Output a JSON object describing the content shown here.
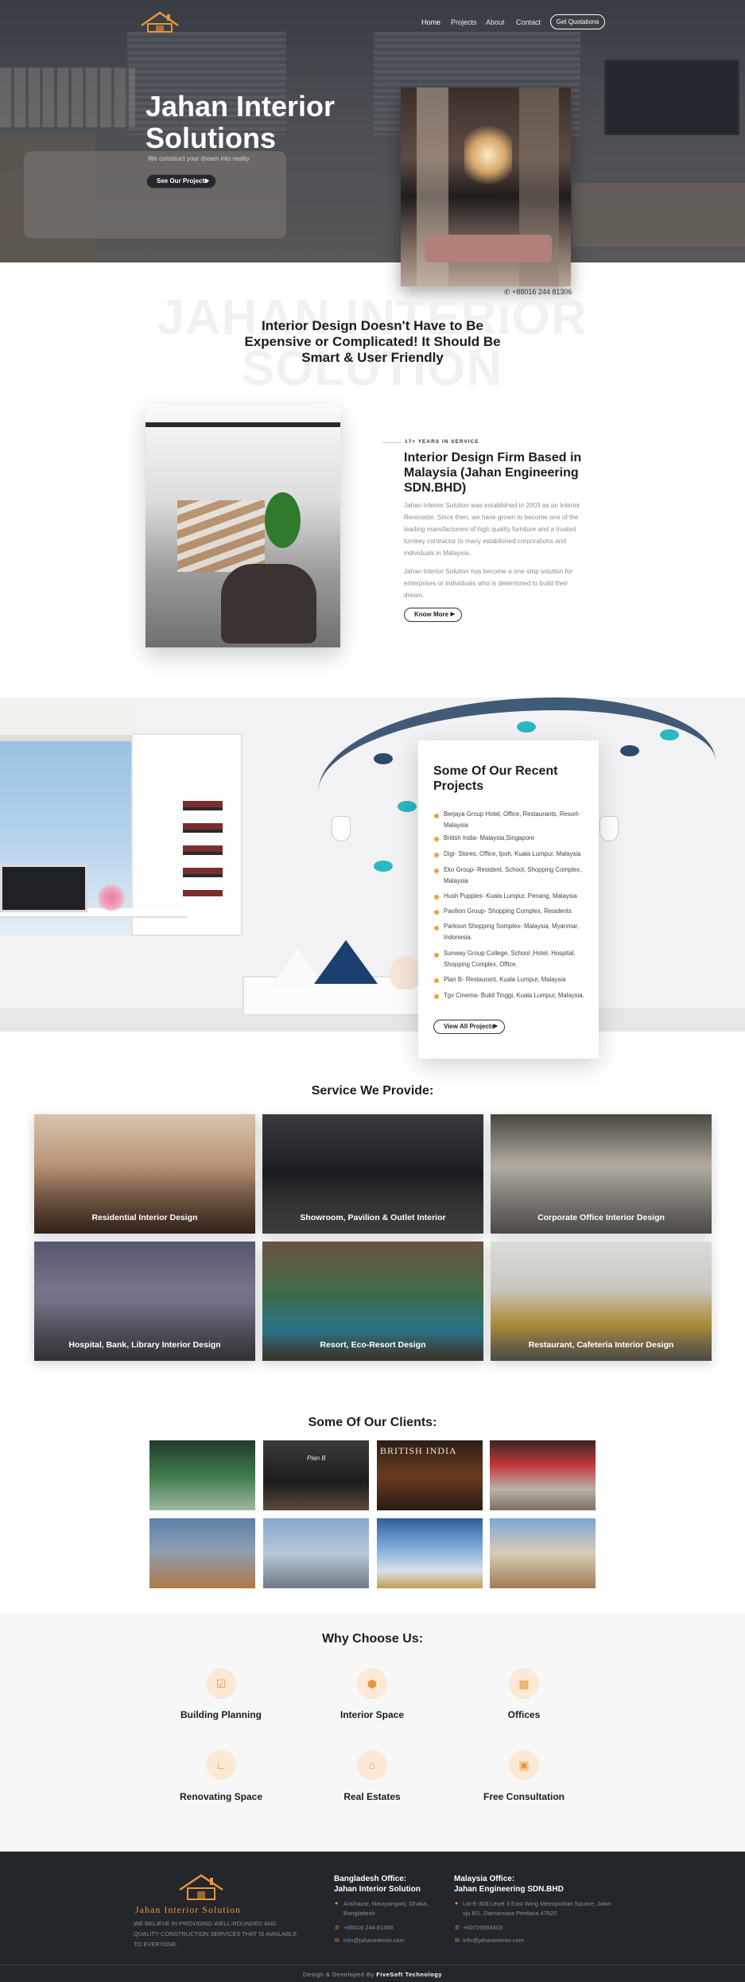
{
  "nav": {
    "items": [
      "Home",
      "Projects",
      "About",
      "Contact"
    ],
    "cta": "Get Quotations"
  },
  "hero": {
    "title": "Jahan Interior Solutions",
    "subtitle": "We construct your dream into reality",
    "button": "See Our Projects",
    "phone": "+88016 244 81306"
  },
  "intro": {
    "watermark": "JAHAN INTERIOR SOLUTION",
    "heading": "Interior Design Doesn't Have to Be Expensive or Complicated! It Should Be Smart & User Friendly"
  },
  "about": {
    "eyebrow": "17+ YEARS IN SERVICE",
    "title": "Interior Design Firm Based in Malaysia (Jahan Engineering SDN.BHD)",
    "para1": "Jahan Interior Solution was established in 2003 as an Interior Renovator. Since then, we have grown to become one of the leading manufacturers of high quality furniture and a trusted turnkey contractor to many established corporations and individuals in Malaysia.",
    "para2": "Jahan Interior Solution has become a one-stop solution for enterprises or individuals who is determined to build their dream.",
    "button": "Know More"
  },
  "projects": {
    "title": "Some Of Our Recent Projects",
    "items": [
      "Berjaya Group Hotel, Office, Restaurants, Resort- Malaysia",
      "British India- Malaysia,Singapore",
      "Digi- Stores, Office, Ipoh, Kuala Lumpur, Malaysia",
      "Eko Group- Resident, School, Shopping Complex, Malaysia",
      "Hush Puppies- Kuala Lumpur, Penang, Malaysia",
      "Pavilion Group- Shopping Complex, Residents",
      "Parkson Shopping Somplex- Malaysia, Myanmar, Indonesia.",
      "Sunway Group College, School ,Hotel, Hospital, Shopping Complex, Office.",
      "Plan B- Restaurant, Kuala Lumpur, Malaysia",
      "Tgv Cinema- Bukit Tinggi, Kuala Lumpur, Malaysia."
    ],
    "button": "View All Projects"
  },
  "services": {
    "title": "Service We Provide:",
    "items": [
      "Residential Interior Design",
      "Showroom, Pavilion & Outlet Interior",
      "Corporate Office Interior Design",
      "Hospital, Bank, Library Interior Design",
      "Resort, Eco-Resort Design",
      "Restaurant, Cafeteria Interior Design"
    ]
  },
  "clients": {
    "title": "Some Of Our Clients:",
    "signs": [
      "Plan B",
      "BRITISH INDIA"
    ]
  },
  "why": {
    "title": "Why Choose Us:",
    "items": [
      {
        "label": "Building Planning",
        "icon": "clipboard-check-icon"
      },
      {
        "label": "Interior Space",
        "icon": "cube-icon"
      },
      {
        "label": "Offices",
        "icon": "building-icon"
      },
      {
        "label": "Renovating Space",
        "icon": "angle-ruler-icon"
      },
      {
        "label": "Real Estates",
        "icon": "home-icon"
      },
      {
        "label": "Free Consultation",
        "icon": "briefcase-icon"
      }
    ]
  },
  "footer": {
    "brand": "Jahan Interior Solution",
    "tagline": "WE BELIEVE IN PROVIDING WELL-ROUNDED AND QUALITY CONSTRUCTION SERVICES THAT IS AVAILABLE TO EVERYONE.",
    "bd": {
      "heading1": "Bangladesh Office:",
      "heading2": "Jahan Interior Solution",
      "address": "Araihazar, Narayanganj, Dhaka, Bangladesh",
      "phone": "+88016 244 81306",
      "email": "info@jahaninterior.com"
    },
    "my": {
      "heading1": "Malaysia Office:",
      "heading2": "Jahan Engineering SDN.BHD",
      "address": "Lot E-308 Level 3 East Wing Metropolitan Square, Jalan sju 8/1, Damansara Perdana 47820",
      "phone": "+60726693403",
      "email": "info@jahaninterior.com"
    },
    "credit_prefix": "Design & Developed By",
    "credit_name": "FiveSoft Technology"
  },
  "colors": {
    "accent": "#e8963a",
    "dark": "#23262b"
  }
}
